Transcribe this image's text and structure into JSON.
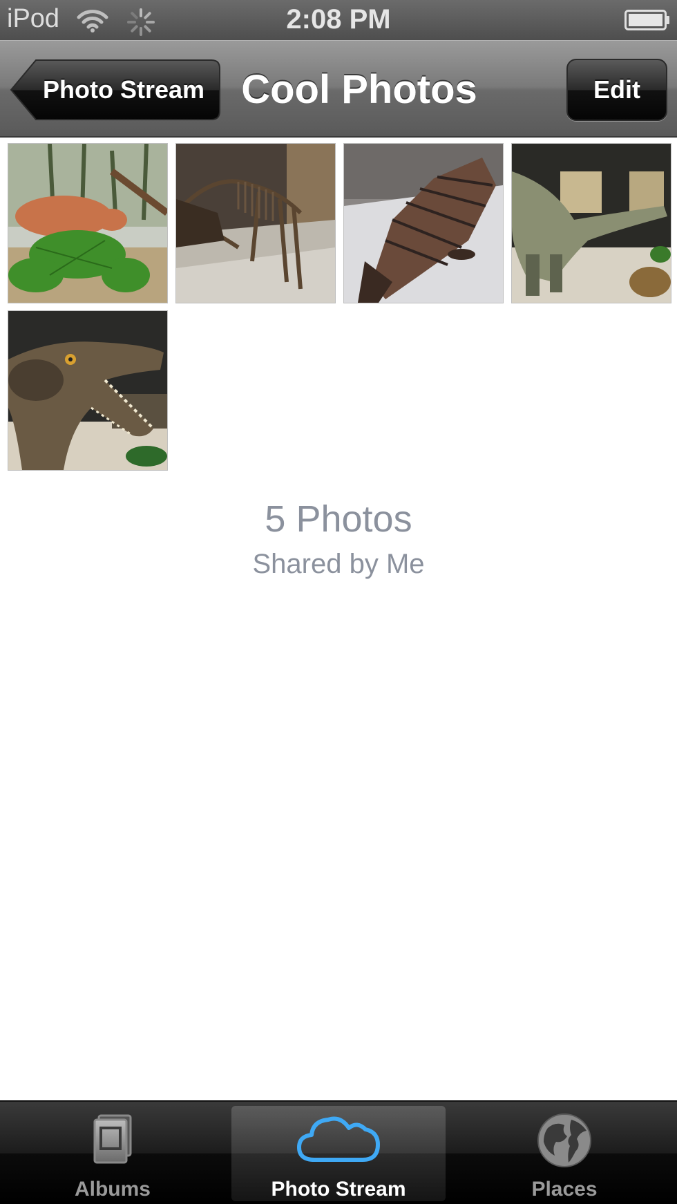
{
  "status": {
    "carrier": "iPod",
    "time": "2:08 PM",
    "icons": [
      "wifi-icon",
      "activity-spinner-icon",
      "battery-icon"
    ]
  },
  "navbar": {
    "back_label": "Photo Stream",
    "title": "Cool Photos",
    "edit_label": "Edit"
  },
  "photos": [
    {
      "label": "thumbnail-1",
      "subject": "furry reptile diorama with ferns"
    },
    {
      "label": "thumbnail-2",
      "subject": "dinosaur skeleton"
    },
    {
      "label": "thumbnail-3",
      "subject": "armored reptile fossil"
    },
    {
      "label": "thumbnail-4",
      "subject": "long-neck dinosaur model"
    },
    {
      "label": "thumbnail-5",
      "subject": "dinosaur head with open jaws"
    }
  ],
  "summary": {
    "count": "5 Photos",
    "shared": "Shared by Me"
  },
  "tabbar": {
    "tabs": [
      {
        "label": "Albums",
        "icon": "albums-icon",
        "selected": false
      },
      {
        "label": "Photo Stream",
        "icon": "cloud-icon",
        "selected": true
      },
      {
        "label": "Places",
        "icon": "globe-icon",
        "selected": false
      }
    ]
  },
  "colors": {
    "summary_text": "#8b919d",
    "cloud_accent": "#3fa9f5"
  }
}
